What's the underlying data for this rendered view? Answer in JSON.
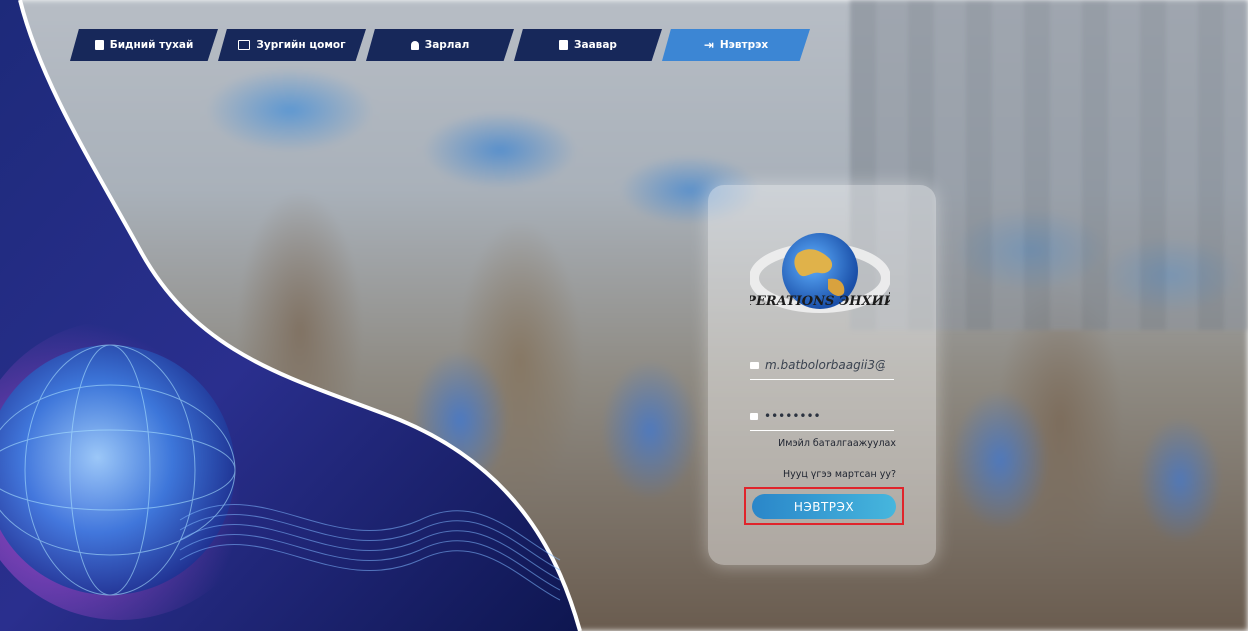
{
  "nav": {
    "items": [
      {
        "label": "Бидний тухай",
        "icon": "document-icon"
      },
      {
        "label": "Зургийн цомог",
        "icon": "image-icon"
      },
      {
        "label": "Зарлал",
        "icon": "bell-icon"
      },
      {
        "label": "Заавар",
        "icon": "document-icon"
      },
      {
        "label": "Нэвтрэх",
        "icon": "login-icon",
        "active": true
      }
    ]
  },
  "login": {
    "logo_text": "OPERATIONS ЭНХИЙГ",
    "email_value": "m.batbolorbaagii3@",
    "password_value": "••••••••",
    "verify_email_link": "Имэйл баталгаажуулах",
    "forgot_password_link": "Нууц үгээ мартсан уу?",
    "submit_label": "НЭВТРЭХ"
  },
  "colors": {
    "nav_bg": "#17285a",
    "nav_active": "#3c86d4",
    "button_gradient_start": "#2a86c9",
    "button_gradient_end": "#46b6dd",
    "highlight_border": "#e0242b"
  }
}
